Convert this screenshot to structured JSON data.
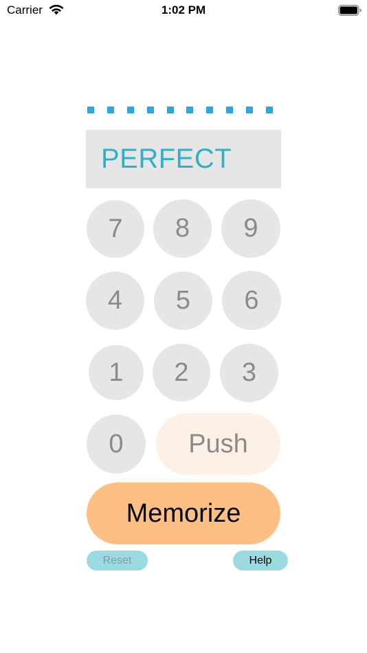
{
  "status_bar": {
    "carrier": "Carrier",
    "time": "1:02 PM",
    "wifi_icon": "wifi-icon",
    "battery_icon": "battery-icon",
    "battery_level": 1.0
  },
  "progress": {
    "dot_count": 10,
    "color": "#2ea7e0"
  },
  "display": {
    "text": "PERFECT",
    "text_color": "#2fb0c7",
    "background": "#e6e6e6"
  },
  "keypad": {
    "keys": [
      "7",
      "8",
      "9",
      "4",
      "5",
      "6",
      "1",
      "2",
      "3",
      "0"
    ],
    "push_label": "Push"
  },
  "memorize_label": "Memorize",
  "reset_label": "Reset",
  "help_label": "Help",
  "colors": {
    "key_bg": "#e6e6e6",
    "push_bg": "#fdf1e6",
    "memorize_bg": "#fdbf82",
    "small_button_bg": "#9adbe2"
  }
}
